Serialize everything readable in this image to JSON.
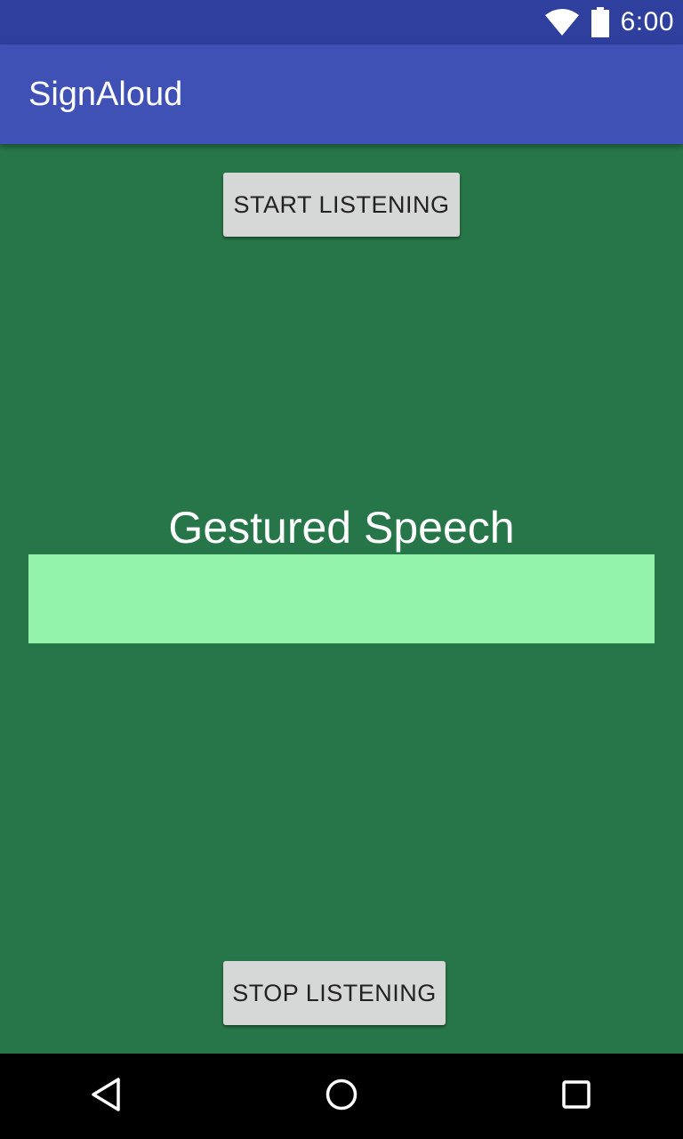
{
  "status_bar": {
    "time": "6:00",
    "icons": [
      "wifi-icon",
      "battery-icon"
    ]
  },
  "app_bar": {
    "title": "SignAloud"
  },
  "main": {
    "start_button_label": "START LISTENING",
    "speech_label": "Gestured Speech",
    "speech_output_text": "",
    "stop_button_label": "STOP LISTENING"
  },
  "nav_bar": {
    "icons": [
      "back-icon",
      "home-icon",
      "recents-icon"
    ]
  },
  "colors": {
    "status_bar": "#2f3f9e",
    "app_bar": "#3f51b5",
    "background": "#277649",
    "speech_output": "#93f3aa",
    "button": "#d6d7d7",
    "nav_bar": "#000000"
  }
}
